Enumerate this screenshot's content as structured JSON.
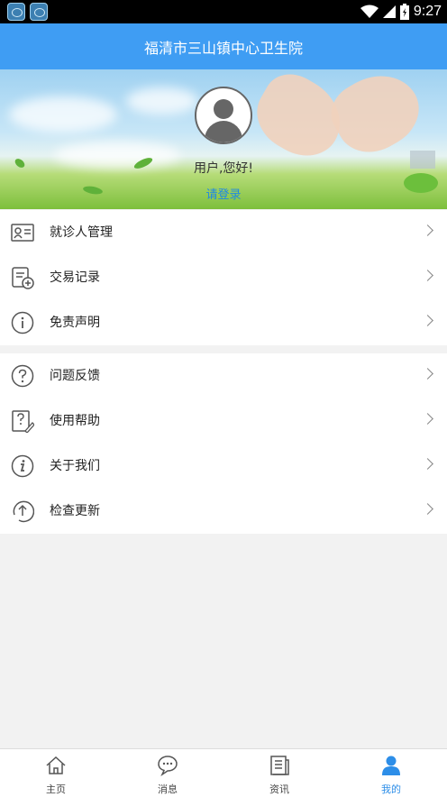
{
  "status_bar": {
    "time": "9:27"
  },
  "header": {
    "title": "福清市三山镇中心卫生院"
  },
  "profile": {
    "greeting": "用户,您好!",
    "login": "请登录"
  },
  "menu_group_1": [
    {
      "label": "就诊人管理",
      "icon": "id-card-icon"
    },
    {
      "label": "交易记录",
      "icon": "record-add-icon"
    },
    {
      "label": "免责声明",
      "icon": "info-icon"
    }
  ],
  "menu_group_2": [
    {
      "label": "问题反馈",
      "icon": "question-icon"
    },
    {
      "label": "使用帮助",
      "icon": "help-edit-icon"
    },
    {
      "label": "关于我们",
      "icon": "info-italic-icon"
    },
    {
      "label": "检查更新",
      "icon": "update-arrow-icon"
    }
  ],
  "tabs": [
    {
      "label": "主页",
      "icon": "home-icon"
    },
    {
      "label": "消息",
      "icon": "chat-bubble-icon"
    },
    {
      "label": "资讯",
      "icon": "news-icon"
    },
    {
      "label": "我的",
      "icon": "person-icon",
      "active": true
    }
  ],
  "colors": {
    "header": "#3f9df3",
    "accent": "#2d8ee8",
    "link": "#1e88e5"
  }
}
